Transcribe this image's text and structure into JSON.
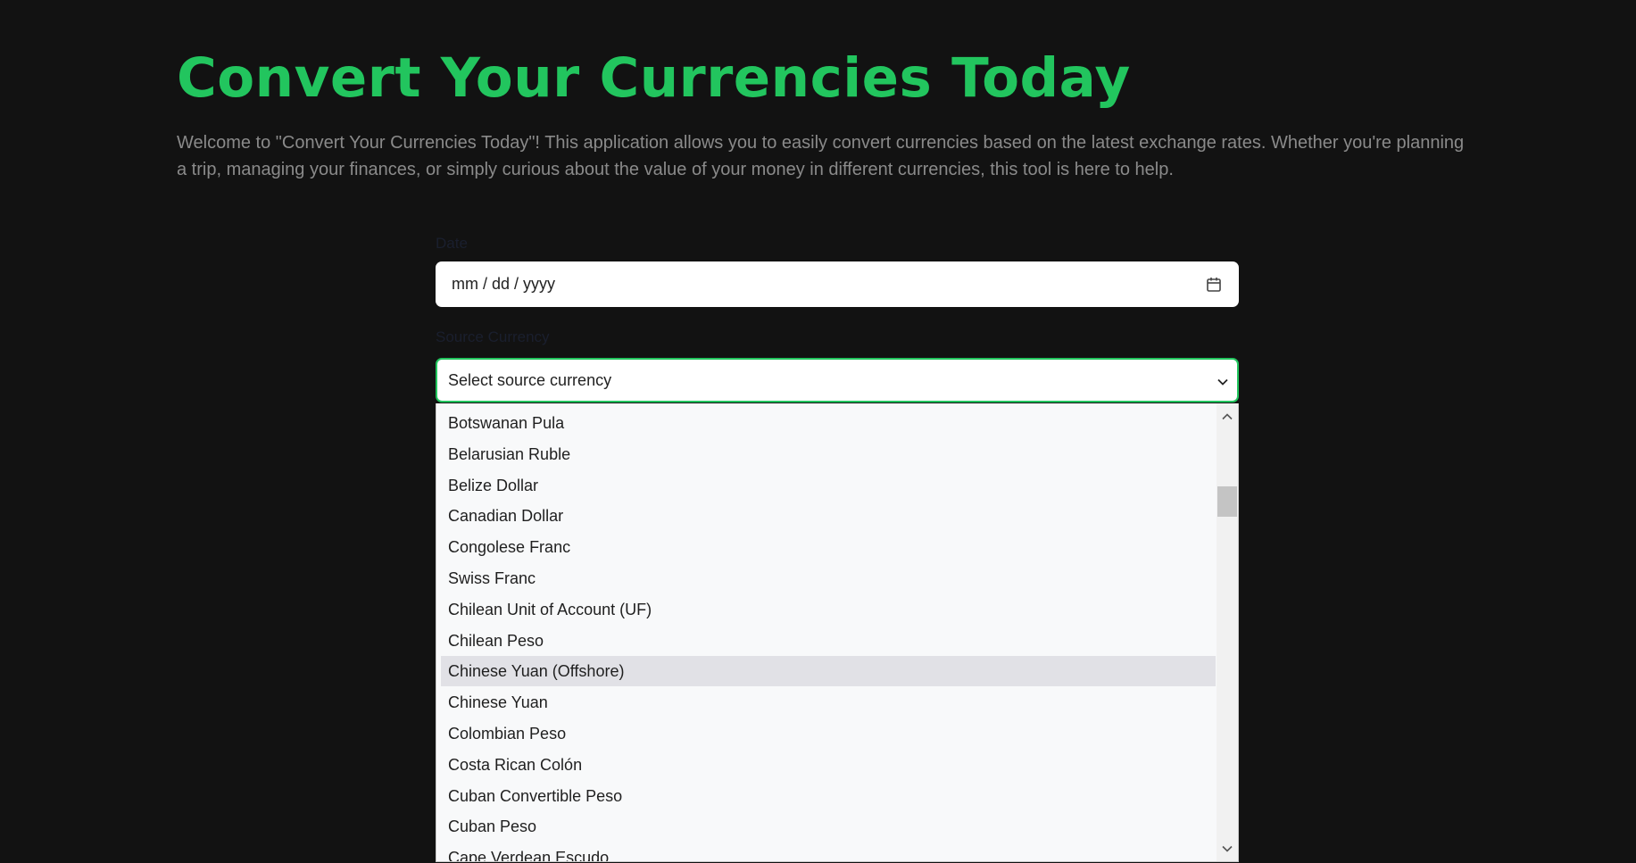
{
  "page": {
    "title": "Convert Your Currencies Today",
    "intro": "Welcome to \"Convert Your Currencies Today\"! This application allows you to easily convert currencies based on the latest exchange rates. Whether you're planning a trip, managing your finances, or simply curious about the value of your money in different currencies, this tool is here to help."
  },
  "form": {
    "date_label": "Date",
    "date_placeholder": "mm / dd / yyyy",
    "source_label": "Source Currency",
    "source_selected": "Select source currency",
    "options": [
      "Botswanan Pula",
      "Belarusian Ruble",
      "Belize Dollar",
      "Canadian Dollar",
      "Congolese Franc",
      "Swiss Franc",
      "Chilean Unit of Account (UF)",
      "Chilean Peso",
      "Chinese Yuan (Offshore)",
      "Chinese Yuan",
      "Colombian Peso",
      "Costa Rican Colón",
      "Cuban Convertible Peso",
      "Cuban Peso",
      "Cape Verdean Escudo"
    ],
    "highlighted_option": "Chinese Yuan (Offshore)"
  },
  "icons": {
    "date": "calendar-icon",
    "select": "chevron-down-icon",
    "scroll_up": "chevron-up-icon",
    "scroll_down": "chevron-down-icon"
  },
  "colors": {
    "background": "#121212",
    "accent": "#22c55e",
    "intro_text": "#8a8a8a",
    "highlight": "#e1e1e6"
  }
}
